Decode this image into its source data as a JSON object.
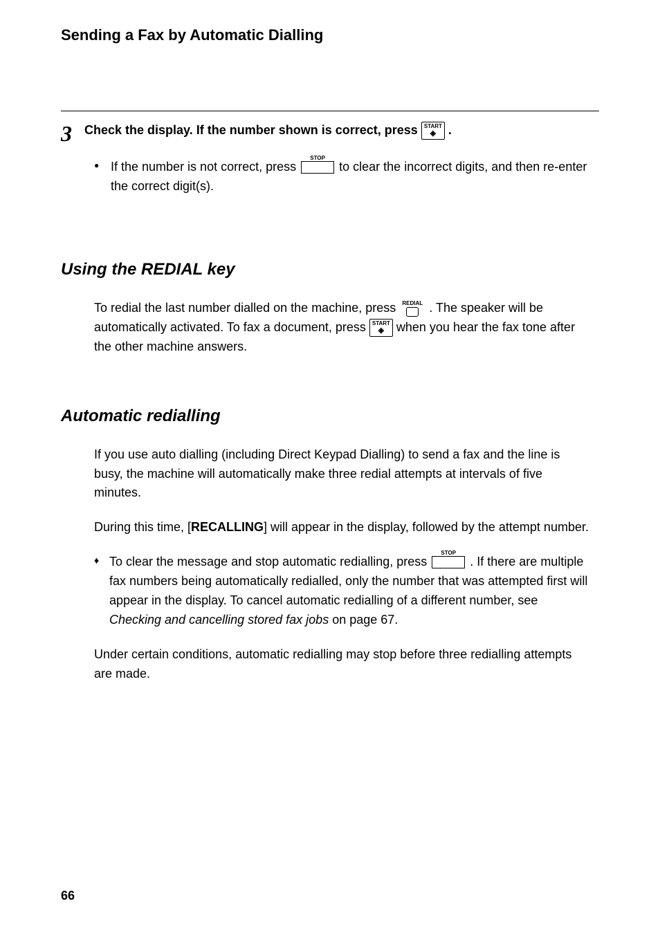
{
  "runningHead": "Sending a Fax by Automatic Dialling",
  "step": {
    "number": "3",
    "main_a": "Check the display. If the number shown is correct, press ",
    "main_b": ".",
    "bullet_a": "If the number is not correct, press ",
    "bullet_b": " to clear the incorrect digits, and then re-enter the correct digit(s).",
    "start_label": "START",
    "start_glyph": "◈",
    "stop_label": "STOP"
  },
  "redial": {
    "heading": "Using the REDIAL key",
    "p1_a": "To redial the last number dialled on the machine, press ",
    "p1_b": ". The speaker will be automatically activated. To fax a document, press ",
    "p1_c": " when you hear the fax tone after the other machine answers.",
    "redial_label": "REDIAL",
    "start_label": "START",
    "start_glyph": "◈"
  },
  "auto": {
    "heading": "Automatic redialling",
    "p1": "If you use auto dialling (including Direct Keypad Dialling) to send a fax and the line is busy, the machine will automatically make three redial attempts at intervals of five minutes.",
    "p2_a": "During this time, [",
    "p2_bold": "RECALLING",
    "p2_b": "] will appear in the display, followed by the attempt number.",
    "bullet_a": "To clear the message and stop automatic redialling, press ",
    "bullet_b": ". If there are multiple fax numbers being automatically redialled, only the number that was attempted first will appear in the display. To cancel automatic redialling of a different number, see ",
    "bullet_ital": "Checking and cancelling stored fax jobs",
    "bullet_c": " on page 67.",
    "stop_label": "STOP",
    "p3": "Under certain conditions, automatic redialling may stop before three redialling attempts are made."
  },
  "pageNumber": "66"
}
